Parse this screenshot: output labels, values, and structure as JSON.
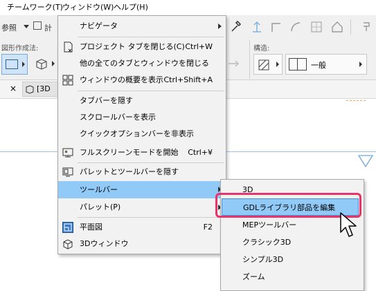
{
  "menubar": {
    "items": [
      {
        "label": "チームワーク(T)"
      },
      {
        "label": "ウィンドウ(W)"
      },
      {
        "label": "ヘルプ(H)"
      }
    ]
  },
  "toolbar": {
    "ref_label": "参照",
    "calc_label": "計"
  },
  "option_bar": {
    "shape_label": "図形作成法:",
    "structure_label": "構造:",
    "structure_value": "一般"
  },
  "tab": {
    "close": "×",
    "label": "[3D"
  },
  "window_menu": {
    "items": [
      {
        "label": "ナビゲータ",
        "shortcut": "",
        "icon": "",
        "submenu": true
      },
      {
        "label": "プロジェクト タブを閉じる(C)",
        "shortcut": "Ctrl+W",
        "icon": "close-tab-icon"
      },
      {
        "label": "他の全てのタブとウィンドウを閉じる",
        "shortcut": "",
        "icon": ""
      },
      {
        "label": "ウィンドウの概要を表示",
        "shortcut": "Ctrl+Shift+A",
        "icon": "window-overview-icon"
      },
      {
        "label": "タブバーを隠す",
        "shortcut": "",
        "icon": ""
      },
      {
        "label": "スクロールバーを表示",
        "shortcut": "",
        "icon": ""
      },
      {
        "label": "クイックオプションバーを非表示",
        "shortcut": "",
        "icon": ""
      },
      {
        "label": "フルスクリーンモードを開始",
        "shortcut": "Ctrl+¥",
        "icon": "fullscreen-icon"
      },
      {
        "label": "パレットとツールバーを隠す",
        "shortcut": "",
        "icon": "hide-palettes-icon"
      },
      {
        "label": "ツールバー",
        "shortcut": "",
        "icon": "",
        "submenu": true,
        "highlighted": true
      },
      {
        "label": "パレット(P)",
        "shortcut": "",
        "icon": "",
        "submenu": true
      },
      {
        "label": "平面図",
        "shortcut": "F2",
        "icon": "floor-plan-icon"
      },
      {
        "label": "3Dウィンドウ",
        "shortcut": "",
        "icon": "3d-window-icon"
      }
    ]
  },
  "toolbar_submenu": {
    "items": [
      {
        "label": "3D"
      },
      {
        "label": "GDLライブラリ部品を編集",
        "highlighted": true
      },
      {
        "label": "MEPツールバー"
      },
      {
        "label": "クラシック3D"
      },
      {
        "label": "シンプル3D"
      },
      {
        "label": "ズーム"
      }
    ]
  },
  "colors": {
    "highlight": "#91c9f7",
    "annotation_border": "#e8336b",
    "accent_blue": "#6fa8dc"
  }
}
